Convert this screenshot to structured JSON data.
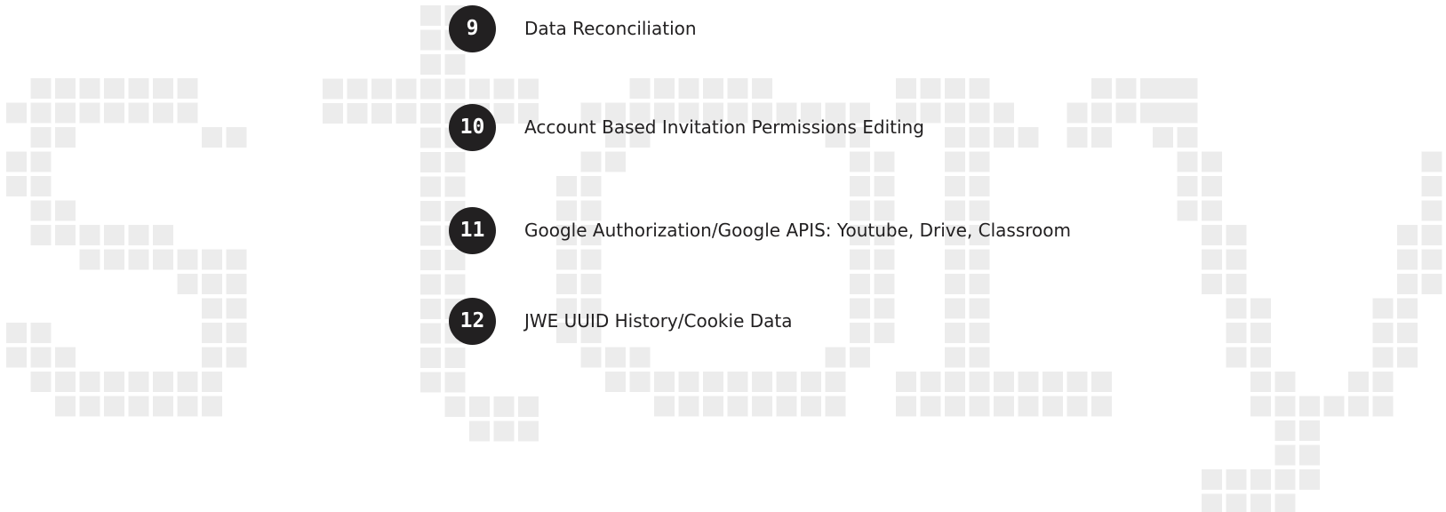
{
  "background": {
    "pattern": "pixel-grid-wordmark",
    "tile_color": "#ececec",
    "glyphs": [
      [
        ".#######.",
        "########.",
        ".##.....##",
        "##.......",
        "##.......",
        ".##......",
        ".######..",
        "...#######",
        ".......###",
        "........##",
        "##......##",
        "###.....##",
        ".########.",
        "..#######."
      ],
      [
        "....##...",
        "....##...",
        "....##...",
        "#########",
        "#########",
        "....##...",
        "....##...",
        "....##...",
        "....##...",
        "....##...",
        "....##...",
        "....##...",
        "....##...",
        "....##...",
        "....##...",
        "....##...",
        ".....####",
        "......###"
      ],
      [
        "...######...",
        ".############",
        "..##.......##",
        ".##.........##",
        "##..........##",
        "##..........##",
        "##..........##",
        "##..........##",
        "##..........##",
        "##..........##",
        "##..........##",
        ".###.......##",
        "..##########",
        "....########"
      ],
      [
        "####....####",
        "#####..#####",
        "..####.##",
        "..##",
        "..##",
        "..##",
        "..##",
        "..##",
        "..##",
        "..##",
        "..##",
        "..##",
        "#########",
        "#########"
      ],
      [
        "##..........##",
        "##..........##",
        "##..........##",
        ".##........##",
        ".##........##",
        ".##........##",
        "..##......##",
        "..##......##",
        "..##......##",
        "...##....##",
        "...##....##",
        "...##....##",
        "....##..##",
        "....######",
        ".....##",
        ".....##",
        "..#####",
        "..####"
      ]
    ]
  },
  "items": [
    {
      "number": "9",
      "label": "Data Reconciliation"
    },
    {
      "number": "10",
      "label": "Account Based Invitation Permissions Editing"
    },
    {
      "number": "11",
      "label": "Google Authorization/Google APIS: Youtube, Drive, Classroom"
    },
    {
      "number": "12",
      "label": "JWE UUID History/Cookie Data"
    }
  ]
}
